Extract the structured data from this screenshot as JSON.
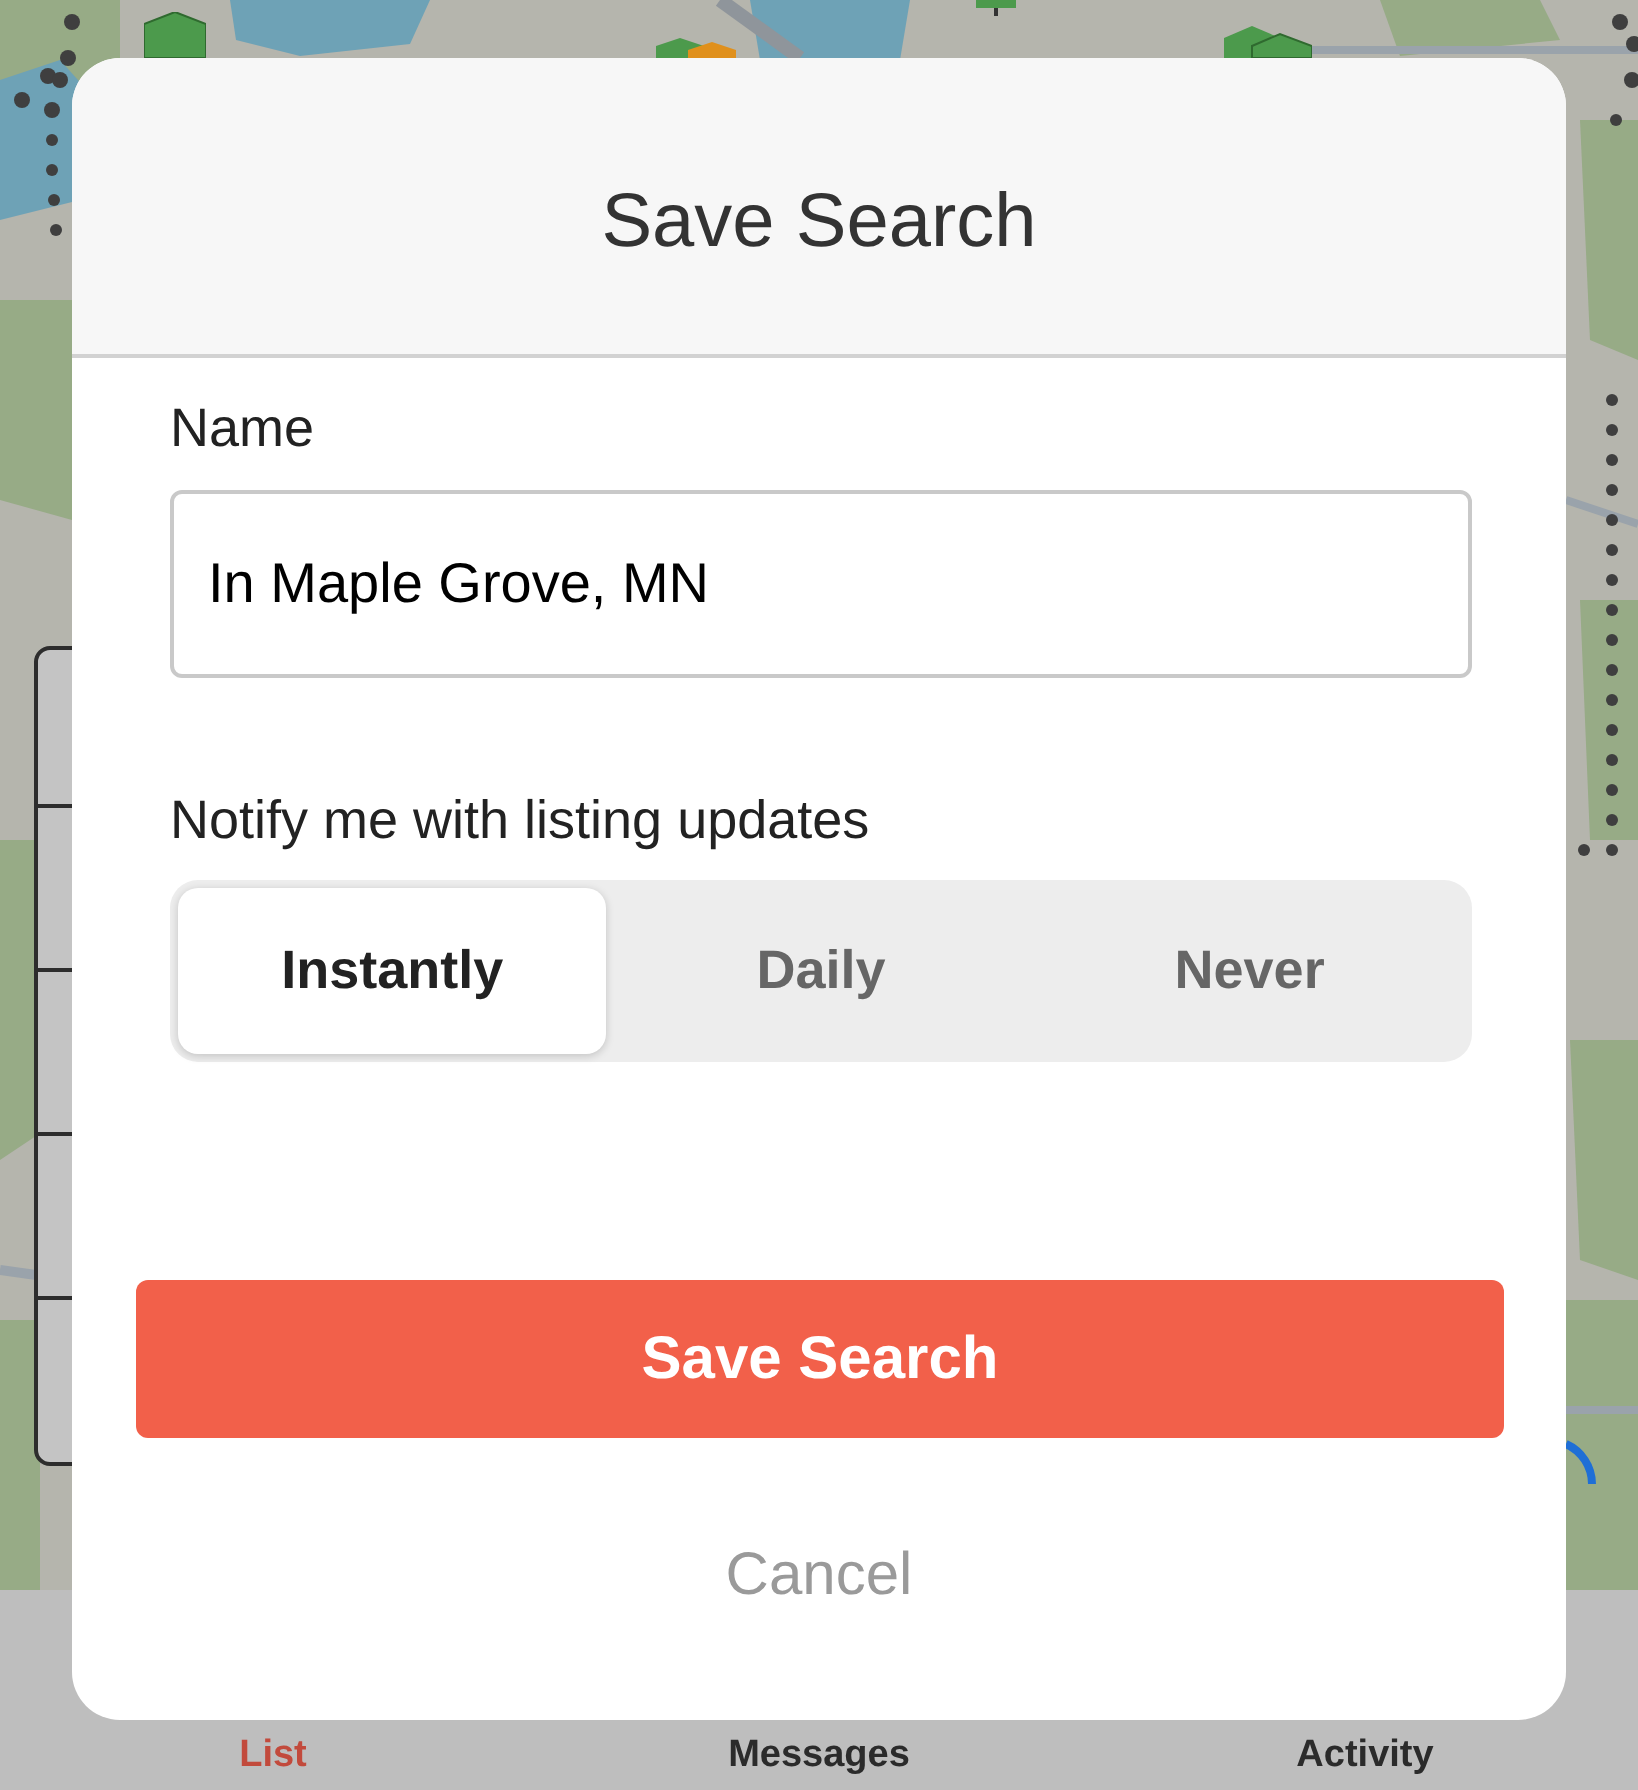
{
  "modal": {
    "title": "Save Search",
    "name_field": {
      "label": "Name",
      "value": "In Maple Grove, MN"
    },
    "notify": {
      "label": "Notify me with listing updates",
      "options": [
        {
          "label": "Instantly",
          "selected": true
        },
        {
          "label": "Daily",
          "selected": false
        },
        {
          "label": "Never",
          "selected": false
        }
      ]
    },
    "save_button": "Save Search",
    "cancel_button": "Cancel"
  },
  "tab_bar": {
    "tabs": [
      {
        "label": "List",
        "selected": true
      },
      {
        "label": "Messages",
        "selected": false
      },
      {
        "label": "Activity",
        "selected": false
      }
    ]
  }
}
